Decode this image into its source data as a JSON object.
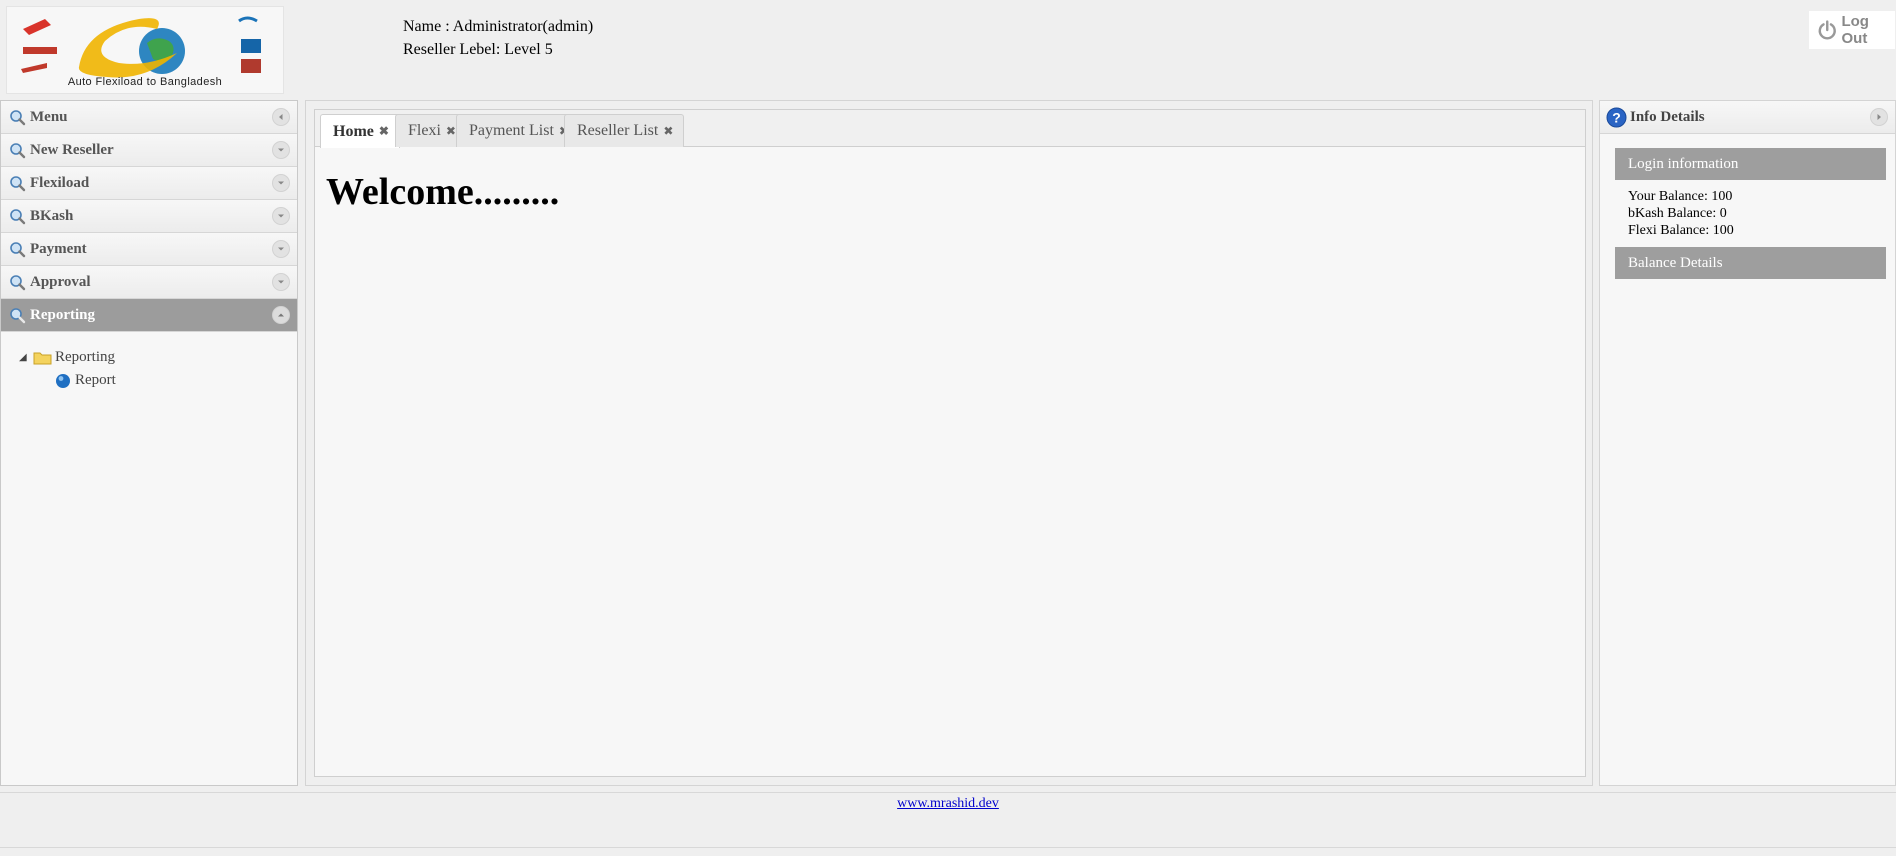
{
  "header": {
    "logo_text": "Auto Flexiload to Bangladesh",
    "user_name": "Name : Administrator(admin)",
    "reseller_level": "Reseller Lebel: Level 5",
    "logout_label": "Log Out"
  },
  "sidebar": {
    "title": "Menu",
    "items": [
      {
        "label": "New Reseller"
      },
      {
        "label": "Flexiload"
      },
      {
        "label": "BKash"
      },
      {
        "label": "Payment"
      },
      {
        "label": "Approval"
      },
      {
        "label": "Reporting"
      }
    ],
    "tree": {
      "folder": "Reporting",
      "child": "Report"
    }
  },
  "tabs": [
    {
      "label": "Home"
    },
    {
      "label": "Flexi"
    },
    {
      "label": "Payment List"
    },
    {
      "label": "Reseller List"
    }
  ],
  "main": {
    "welcome": "Welcome........."
  },
  "right_panel": {
    "title": "Info Details",
    "login_section": "Login information",
    "balances": [
      "Your Balance: 100",
      "bKash Balance: 0",
      "Flexi Balance: 100"
    ],
    "balance_section": "Balance Details"
  },
  "footer": {
    "link": "www.mrashid.dev"
  },
  "colors": {
    "active_header": "#9c9c9c",
    "section_bar": "#9e9e9e",
    "background": "#efefef",
    "link": "#0000cc"
  }
}
